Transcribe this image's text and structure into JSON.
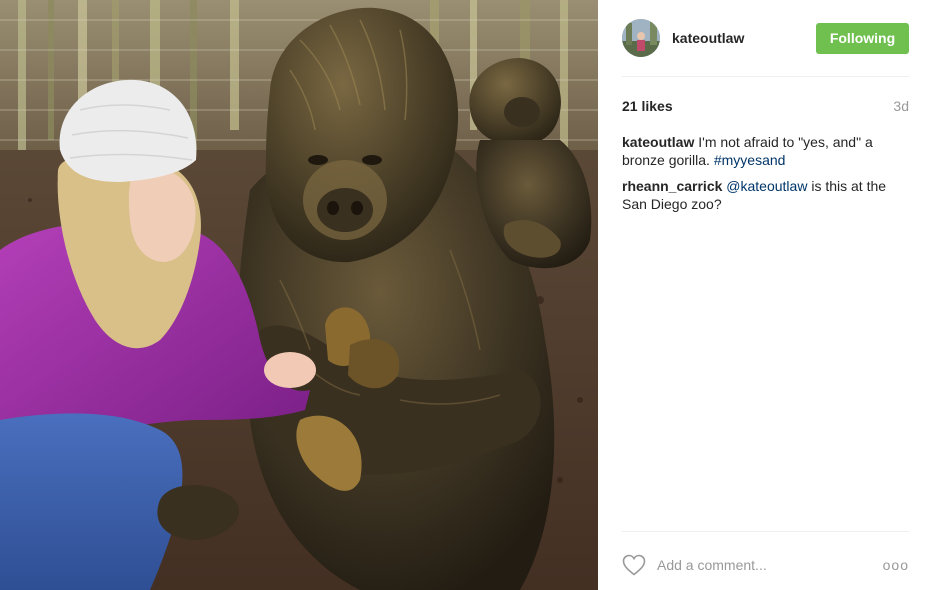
{
  "post": {
    "image_alt": "Woman in purple fleece and white knit hat beside a bronze gorilla statue with a baby gorilla on its back"
  },
  "header": {
    "username": "kateoutlaw",
    "follow_label": "Following",
    "avatar_icon": "profile-avatar"
  },
  "stats": {
    "likes": "21 likes",
    "time_ago": "3d"
  },
  "comments": [
    {
      "user": "kateoutlaw",
      "text": "I'm not afraid to \"yes, and\" a bronze gorilla.",
      "link": "#myyesand"
    },
    {
      "user": "rheann_carrick",
      "link": "@kateoutlaw",
      "text": "is this at the San Diego zoo?"
    }
  ],
  "footer": {
    "comment_placeholder": "Add a comment...",
    "more_label": "ooo",
    "heart_icon": "heart-outline"
  },
  "colors": {
    "following_button": "#70c050",
    "link": "#003569",
    "muted": "#999999"
  }
}
